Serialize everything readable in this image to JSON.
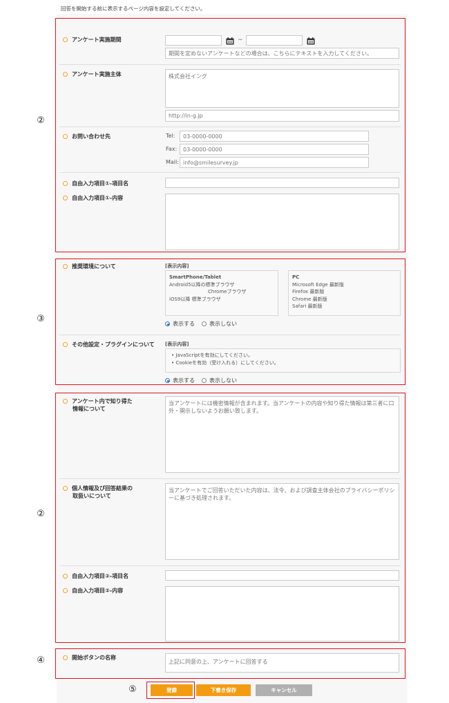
{
  "intro_text": "回答を開始する前に表示するページ内容を設定してください。",
  "markers": {
    "m2": "②",
    "m3": "③",
    "m4": "④",
    "m5": "⑤"
  },
  "survey_period": {
    "label": "アンケート実施期間",
    "tilde": "~",
    "start_value": "",
    "end_value": "",
    "note_placeholder": "期間を定めないアンケートなどの場合は、こちらにテキストを入力してください。"
  },
  "organizer": {
    "label": "アンケート実施主体",
    "name_value": "株式会社イング",
    "url_value": "http://in-g.jp"
  },
  "contact": {
    "label": "お問い合わせ先",
    "tel_label": "Tel:",
    "tel_value": "03-0000-0000",
    "fax_label": "Fax:",
    "fax_value": "03-0000-0000",
    "mail_label": "Mail:",
    "mail_value": "info@smilesurvey.jp"
  },
  "free1": {
    "name_label": "自由入力項目①-項目名",
    "content_label": "自由入力項目①-内容"
  },
  "environment": {
    "label": "推奨環境について",
    "display_tag": "[表示内容]",
    "sp_title": "SmartPhone/Tablet",
    "sp_line1": "Android5以降の標準ブラウザ",
    "sp_line2": "Chromeブラウザ",
    "sp_line3": "iOS9以降 標準ブラウザ",
    "pc_title": "PC",
    "pc_line1": "Microsoft Edge 最新版",
    "pc_line2": "Firefox 最新版",
    "pc_line3": "Chrome 最新版",
    "pc_line4": "Safari 最新版",
    "show": "表示する",
    "hide": "表示しない"
  },
  "plugins": {
    "label": "その他設定・プラグインについて",
    "display_tag": "[表示内容]",
    "line1": "JavaScriptを有効にしてください。",
    "line2": "Cookieを有効（受け入れる）にしてください。",
    "show": "表示する",
    "hide": "表示しない"
  },
  "confidential": {
    "label_line1": "アンケート内で知り得た",
    "label_line2": "情報について",
    "value": "当アンケートには機密情報が含まれます。当アンケートの内容や知り得た情報は第三者に口外・開示しないようお願い致します。"
  },
  "privacy": {
    "label_line1": "個人情報及び回答結果の",
    "label_line2": "取扱いについて",
    "value": "当アンケートでご回答いただいた内容は、法令、および調査主体会社のプライバシーポリシーに基づき処理されます。"
  },
  "free2": {
    "name_label": "自由入力項目②-項目名",
    "content_label": "自由入力項目②-内容"
  },
  "start_button_name": {
    "label": "開始ボタンの名称",
    "placeholder": "上記に同意の上、アンケートに回答する"
  },
  "buttons": {
    "register": "登録",
    "draft": "下書き保存",
    "cancel": "キャンセル"
  },
  "colors": {
    "frame": "#d9141d",
    "bullet": "#f0a020",
    "primary_button": "#f39c12",
    "cancel_button": "#b0b0b0"
  }
}
